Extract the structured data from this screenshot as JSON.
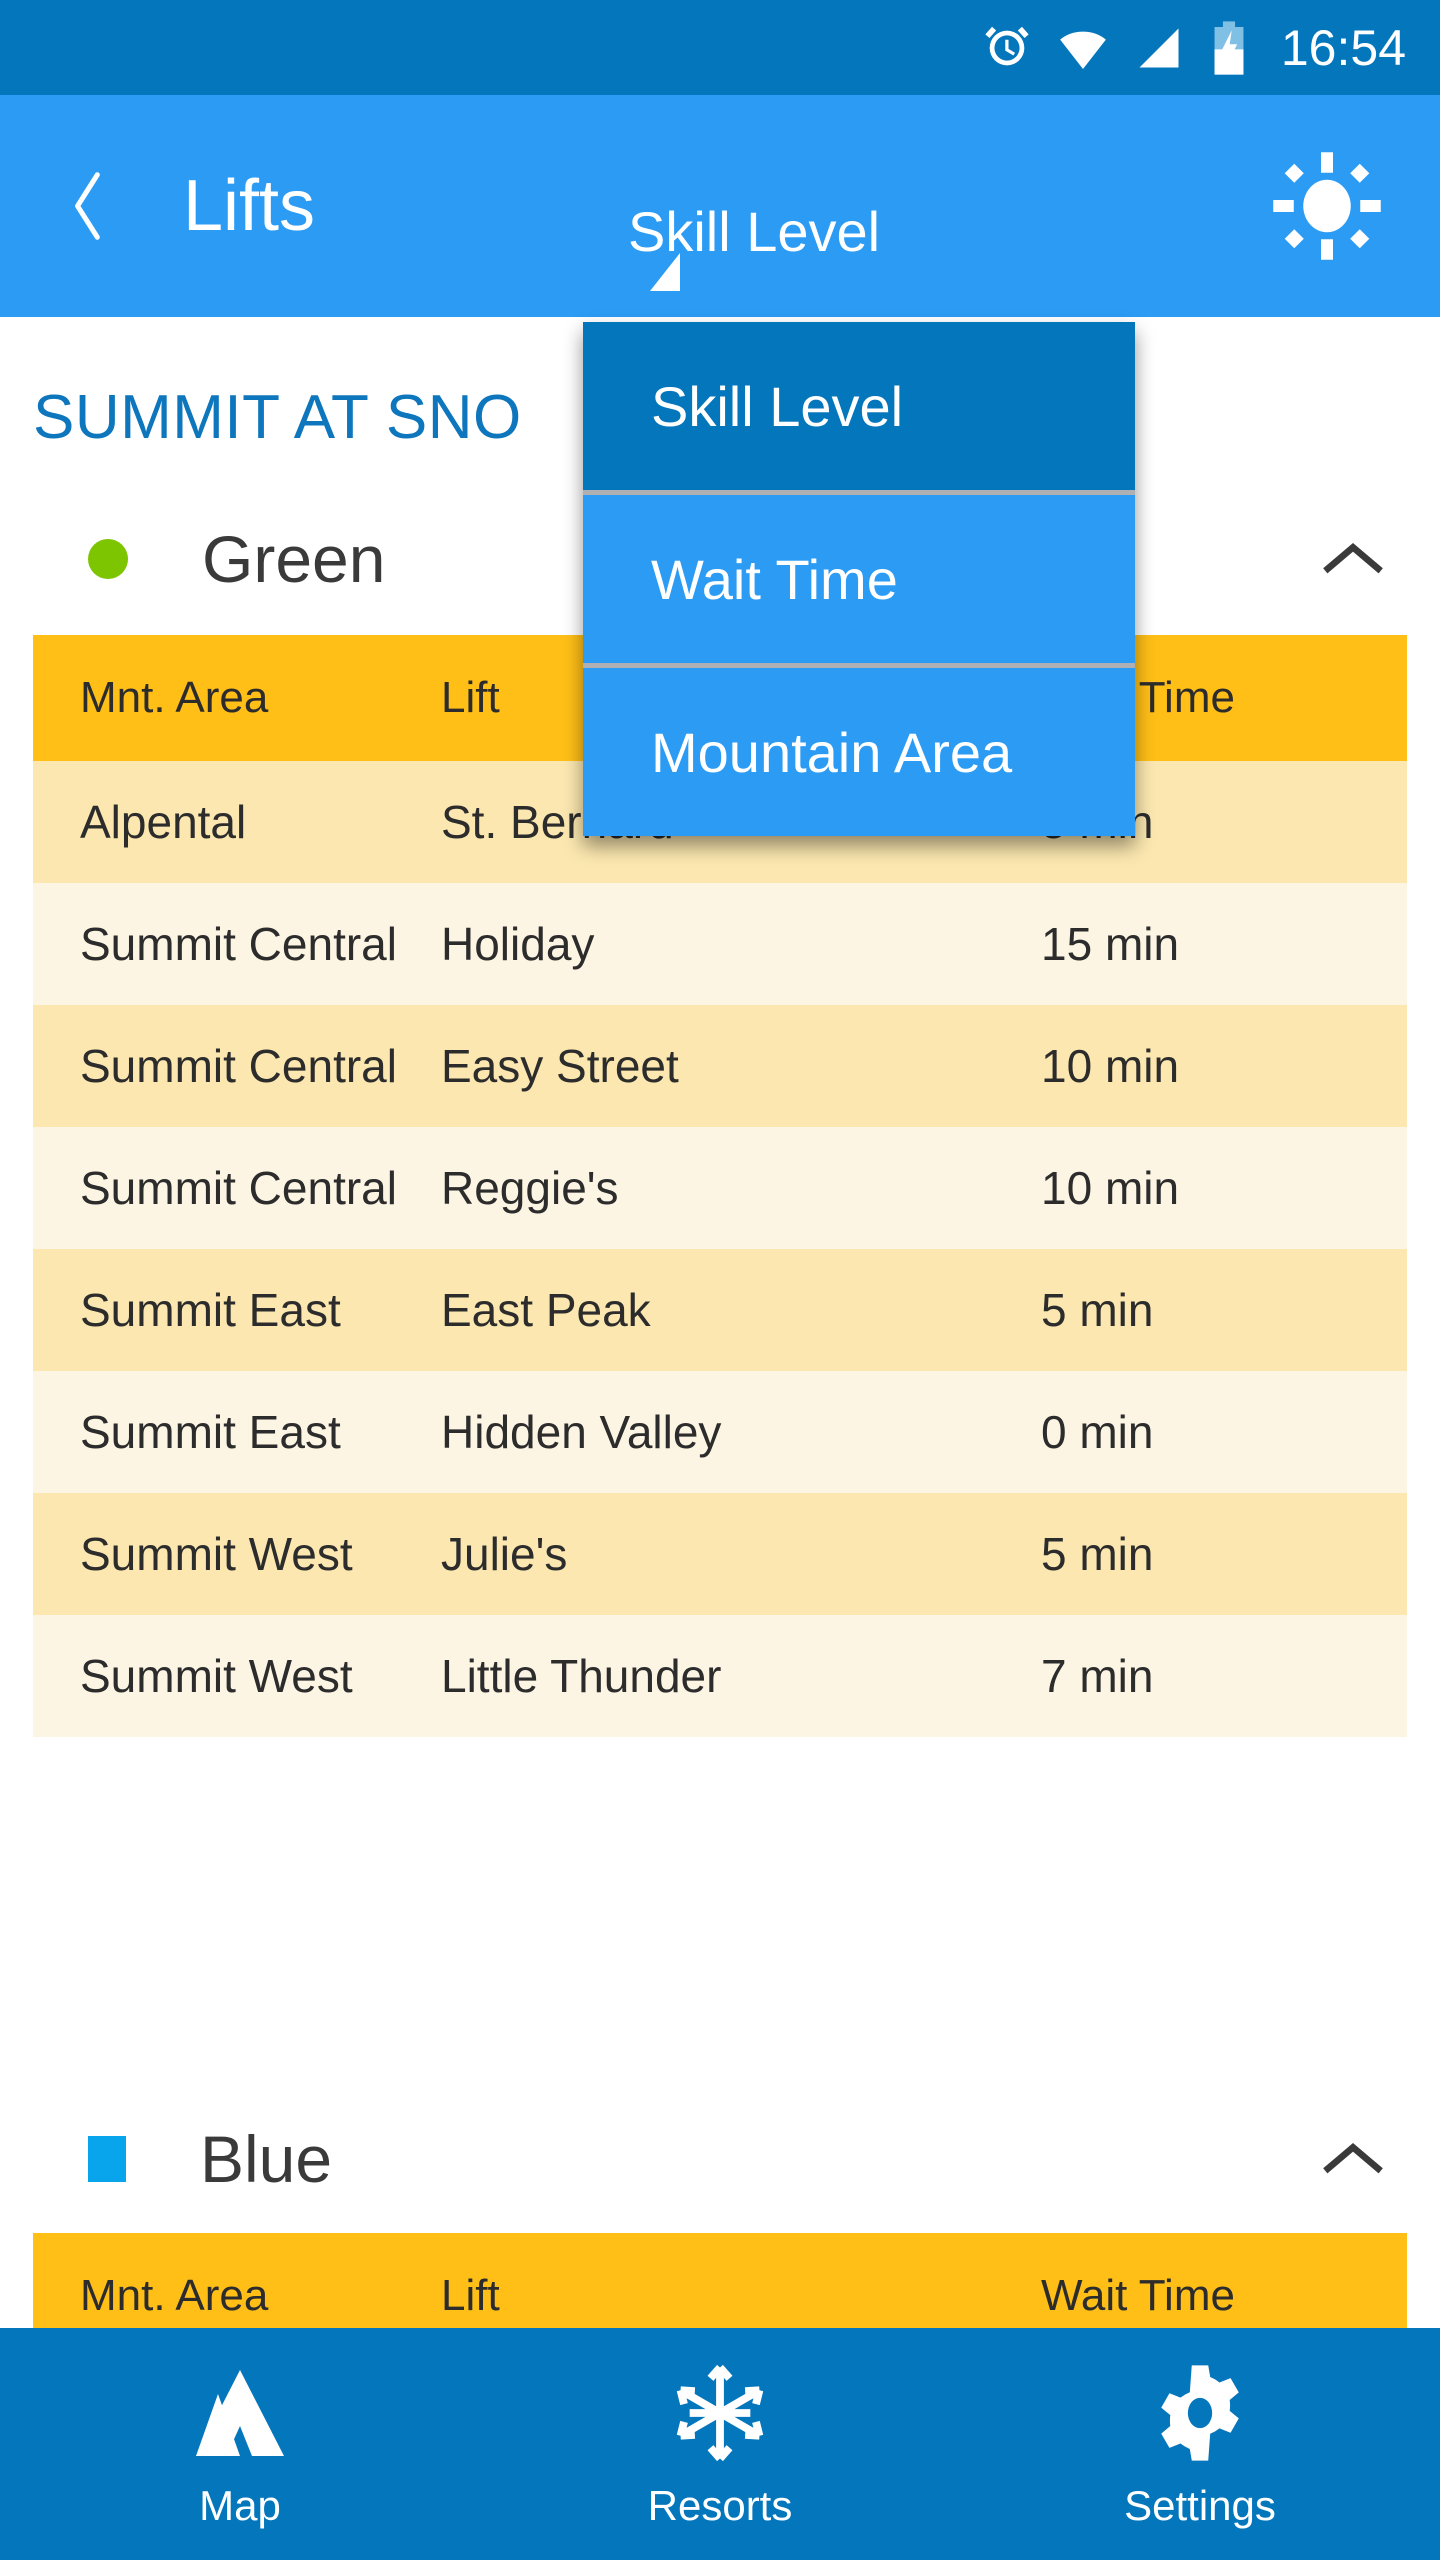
{
  "status_bar": {
    "time": "16:54",
    "icons": [
      "alarm-icon",
      "wifi-icon",
      "signal-icon",
      "battery-charging-icon"
    ],
    "background": "#0476BC"
  },
  "app_bar": {
    "back_label": "‹",
    "title": "Lifts",
    "background": "#2B9BF4",
    "spinner": {
      "selected": "Skill Level",
      "options": [
        "Skill Level",
        "Wait Time",
        "Mountain Area"
      ]
    },
    "weather_icon": "sun-icon"
  },
  "dropdown": {
    "open": true,
    "selected_index": 0,
    "items": [
      {
        "label": "Skill Level"
      },
      {
        "label": "Wait Time"
      },
      {
        "label": "Mountain Area"
      }
    ],
    "selected_background": "#0476BC",
    "item_background": "#2B9BF4",
    "divider_color": "#AEB0B3"
  },
  "resort": {
    "title": "SUMMIT AT SNO",
    "title_color": "#0E76BC"
  },
  "columns": [
    "Mnt. Area",
    "Lift",
    "Wait Time"
  ],
  "sections": [
    {
      "name": "Green",
      "marker_shape": "dot",
      "marker_color": "#7DC500",
      "collapse_icon": "chevron-up-icon",
      "expanded": true,
      "rows": [
        {
          "area": "Alpental",
          "lift": "St. Bernard",
          "wait": "5 min"
        },
        {
          "area": "Summit Central",
          "lift": "Holiday",
          "wait": "15 min"
        },
        {
          "area": "Summit Central",
          "lift": "Easy Street",
          "wait": "10 min"
        },
        {
          "area": "Summit Central",
          "lift": "Reggie's",
          "wait": "10 min"
        },
        {
          "area": "Summit East",
          "lift": "East Peak",
          "wait": "5 min"
        },
        {
          "area": "Summit East",
          "lift": "Hidden Valley",
          "wait": "0 min"
        },
        {
          "area": "Summit West",
          "lift": "Julie's",
          "wait": "5 min"
        },
        {
          "area": "Summit West",
          "lift": "Little Thunder",
          "wait": "7 min"
        }
      ]
    },
    {
      "name": "Blue",
      "marker_shape": "square",
      "marker_color": "#08A4EC",
      "collapse_icon": "chevron-up-icon",
      "expanded": true,
      "rows": []
    }
  ],
  "table_colors": {
    "header": "#FFBF17",
    "row_odd": "#FBE7AF",
    "row_even": "#FDF5E3"
  },
  "bottom_nav": {
    "background": "#0476BC",
    "items": [
      {
        "label": "Map",
        "icon": "mountain-icon"
      },
      {
        "label": "Resorts",
        "icon": "snowflake-icon"
      },
      {
        "label": "Settings",
        "icon": "gear-icon"
      }
    ]
  }
}
